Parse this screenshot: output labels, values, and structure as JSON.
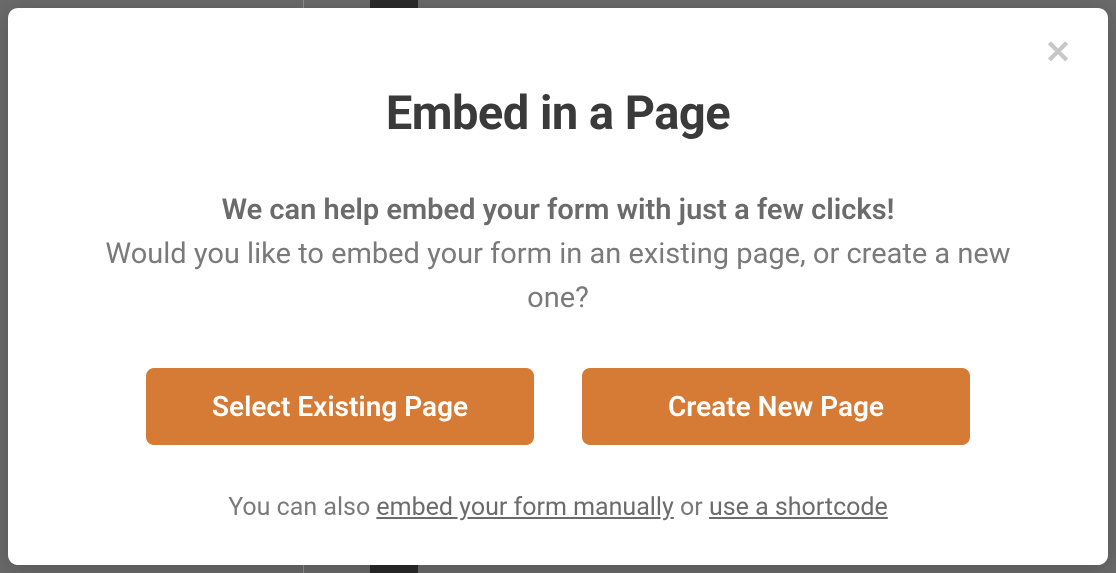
{
  "modal": {
    "title": "Embed in a Page",
    "subtitle": "We can help embed your form with just a few clicks!",
    "question": "Would you like to embed your form in an existing page, or create a new one?",
    "buttons": {
      "select_existing": "Select Existing Page",
      "create_new": "Create New Page"
    },
    "footer": {
      "prefix": "You can also ",
      "link_manual": "embed your form manually",
      "middle": " or ",
      "link_shortcode": "use a shortcode"
    }
  }
}
